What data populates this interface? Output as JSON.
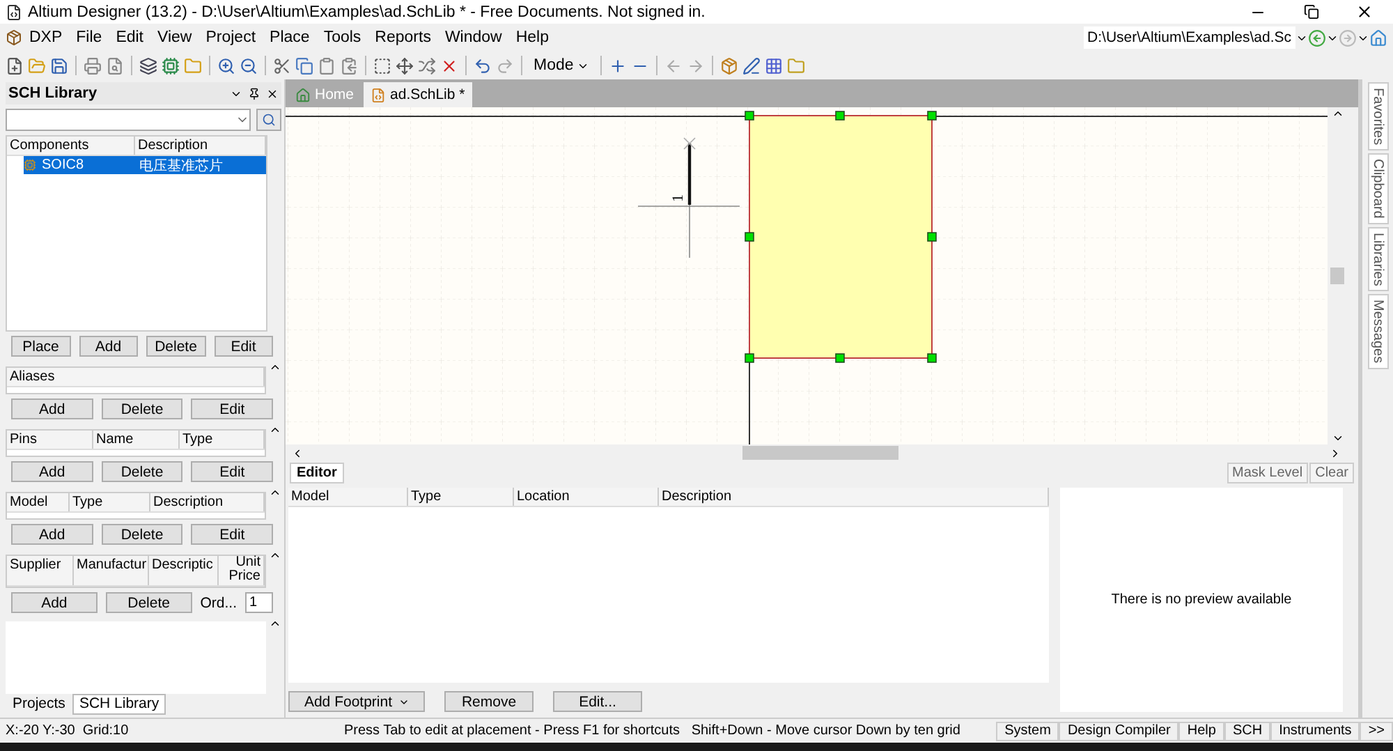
{
  "window": {
    "title": "Altium Designer (13.2) - D:\\User\\Altium\\Examples\\ad.SchLib * - Free Documents. Not signed in."
  },
  "menu": [
    "DXP",
    "File",
    "Edit",
    "View",
    "Project",
    "Place",
    "Tools",
    "Reports",
    "Window",
    "Help"
  ],
  "toolbar": {
    "mode_label": "Mode"
  },
  "address": {
    "value": "D:\\User\\Altium\\Examples\\ad.Sc"
  },
  "left_panel": {
    "title": "SCH Library",
    "components": {
      "columns": [
        "Components",
        "Description"
      ],
      "rows": [
        {
          "name": "SOIC8",
          "description": "电压基准芯片",
          "selected": true
        }
      ],
      "buttons": [
        "Place",
        "Add",
        "Delete",
        "Edit"
      ]
    },
    "aliases": {
      "columns": [
        "Aliases"
      ],
      "buttons": [
        "Add",
        "Delete",
        "Edit"
      ]
    },
    "pins": {
      "columns": [
        "Pins",
        "Name",
        "Type"
      ],
      "buttons": [
        "Add",
        "Delete",
        "Edit"
      ]
    },
    "models": {
      "columns": [
        "Model",
        "Type",
        "Description"
      ],
      "buttons": [
        "Add",
        "Delete",
        "Edit"
      ]
    },
    "suppliers": {
      "columns": [
        "Supplier",
        "Manufactur",
        "Descriptic",
        "Unit Price"
      ],
      "buttons": [
        "Add",
        "Delete",
        "Ord..."
      ],
      "spinner": "1"
    },
    "bottom_tabs": [
      {
        "label": "Projects",
        "selected": false
      },
      {
        "label": "SCH Library",
        "selected": true
      }
    ]
  },
  "doc_tabs": [
    {
      "label": "Home",
      "selected": false
    },
    {
      "label": "ad.SchLib *",
      "selected": true
    }
  ],
  "canvas": {
    "pin_number": "1"
  },
  "editor": {
    "tab": "Editor",
    "tools": [
      "Mask Level",
      "Clear"
    ],
    "columns": [
      "Model",
      "Type",
      "Location",
      "Description"
    ],
    "preview_message": "There is no preview available",
    "actions": [
      "Add Footprint",
      "Remove",
      "Edit..."
    ]
  },
  "side_tabs": [
    "Favorites",
    "Clipboard",
    "Libraries",
    "Messages"
  ],
  "status_bar": {
    "coords": "X:-20 Y:-30",
    "grid": "Grid:10",
    "hint": "Press Tab to edit at placement - Press F1 for shortcuts",
    "shortcut": "Shift+Down - Move cursor Down by ten grid",
    "buttons": [
      "System",
      "Design Compiler",
      "Help",
      "SCH",
      "Instruments",
      ">>"
    ]
  }
}
